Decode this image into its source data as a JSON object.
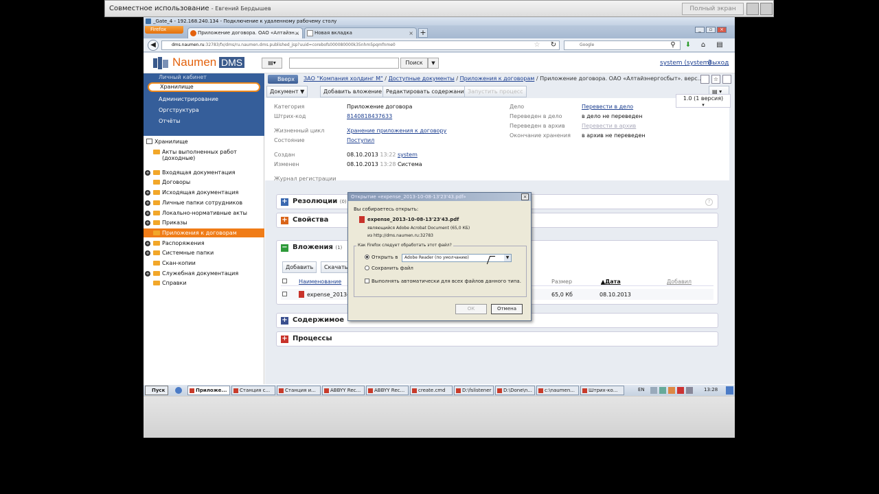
{
  "share": {
    "title": "Совместное использование",
    "presenter": "- Евгений Бердышев",
    "fullscreen": "Полный экран"
  },
  "rdp": {
    "title": "_Gate_4 - 192.168.240.134 - Подключение к удаленному рабочему столу"
  },
  "firefox": {
    "menu_label": "Firefox",
    "tabs": [
      {
        "label": "Приложение договора. ОАО «Алтайэн...",
        "close": "×"
      },
      {
        "label": "Новая вкладка",
        "close": "×"
      }
    ],
    "new_tab": "+",
    "url_host": "dms.naumen.ru",
    "url_rest": ":32783/fx/dms/ru.naumen.dms.published_jsp?uuid=corebofs000080000k35nhm5pqmfnme0",
    "search_placeholder": "Google"
  },
  "header": {
    "logo": "Naumen",
    "logo_dms": "DMS",
    "search_btn": "Поиск",
    "user": "system (system)",
    "logout": "Выход"
  },
  "sidebar": {
    "top_items": [
      "Личный кабинет",
      "Хранилище",
      "Администрирование",
      "Оргструктура",
      "Отчёты"
    ],
    "tree_root": "Хранилище",
    "tree": [
      {
        "label": "Акты выполненных работ",
        "label2": "(доходные)",
        "plus": false
      },
      {
        "label": "Входящая документация",
        "plus": true
      },
      {
        "label": "Договоры",
        "plus": false
      },
      {
        "label": "Исходящая документация",
        "plus": true
      },
      {
        "label": "Личные папки сотрудников",
        "plus": true
      },
      {
        "label": "Локально-нормативные акты",
        "plus": true
      },
      {
        "label": "Приказы",
        "plus": true
      },
      {
        "label": "Приложения к договорам",
        "plus": false
      },
      {
        "label": "Распоряжения",
        "plus": true
      },
      {
        "label": "Системные папки",
        "plus": true
      },
      {
        "label": "Скан-копии",
        "plus": false
      },
      {
        "label": "Служебная документация",
        "plus": true
      },
      {
        "label": "Справки",
        "plus": false
      }
    ]
  },
  "main": {
    "up": "Вверх",
    "crumbs": [
      {
        "text": "ЗАО \"Компания холдинг М\"",
        "link": true
      },
      {
        "text": " / ",
        "link": false
      },
      {
        "text": "Доступные документы",
        "link": true
      },
      {
        "text": " / ",
        "link": false
      },
      {
        "text": "Приложения к договорам",
        "link": true
      },
      {
        "text": " / Приложение договора. ОАО «Алтайэнергосбыт». верс...",
        "link": false
      }
    ],
    "actions": [
      "Документ ▼",
      "Добавить вложение",
      "Редактировать содержание",
      "Запустить процесс"
    ],
    "version": "1.0 (1 версия)",
    "fields": {
      "category_l": "Категория",
      "category_v": "Приложение договора",
      "barcode_l": "Штрих-код",
      "barcode_v": "8140818437633",
      "lifecycle_l": "Жизненный цикл",
      "lifecycle_v": "Хранение приложения к договору",
      "state_l": "Состояние",
      "state_v": "Поступил",
      "created_l": "Создан",
      "created_date": "08.10.2013",
      "created_time": "13:22",
      "created_by": "system",
      "changed_l": "Изменен",
      "changed_date": "08.10.2013",
      "changed_time": "13:28",
      "changed_by": "Система",
      "journal_l": "Журнал регистрации",
      "case_l": "Дело",
      "case_v": "Перевести в дело",
      "to_case_l": "Переведен в дело",
      "to_case_v": "в дело не переведен",
      "to_archive_l": "Переведен в архив",
      "to_archive_v": "Перевести в архив",
      "storage_end_l": "Окончание хранения",
      "storage_end_v": "в архив не переведен"
    },
    "sections": {
      "resolutions": "Резолюции",
      "resolutions_cnt": "(0)",
      "properties": "Свойства",
      "attachments": "Вложения",
      "attachments_cnt": "(1)",
      "content": "Содержимое",
      "processes": "Процессы"
    },
    "attach": {
      "add": "Добавить",
      "download": "Скачать",
      "col_name": "Наименование",
      "col_size": "Размер",
      "col_date": "Дата",
      "col_added": "Добавил",
      "file": "expense_2013-",
      "size": "65,0 Кб",
      "date": "08.10.2013"
    }
  },
  "dialog": {
    "title": "Открытие «expense_2013-10-08-13'23'43.pdf»",
    "intro": "Вы собираетесь открыть:",
    "filename": "expense_2013-10-08-13'23'43.pdf",
    "type": "являющийся  Adobe Acrobat Document (65,0 КБ)",
    "from": "из  http://dms.naumen.ru:32783",
    "question": "Как Firefox следует обработать этот файл?",
    "open_with": "Открыть в",
    "app": "Adobe Reader  (по умолчанию)",
    "save": "Сохранить файл",
    "auto": "Выполнять автоматически для всех файлов данного типа.",
    "ok": "ОК",
    "cancel": "Отмена"
  },
  "taskbar": {
    "start": "Пуск",
    "tasks": [
      "Приложе...",
      "Станция с...",
      "Станция и...",
      "ABBYY Rec...",
      "ABBYY Rec...",
      "create.cmd",
      "D:\\fslistener",
      "D:\\Done\\n...",
      "c:\\naumen...",
      "Штрих-ко..."
    ],
    "lang": "EN",
    "clock": "13:28"
  },
  "colors": {
    "accent": "#e3620e",
    "nav_blue": "#355e9a",
    "selected": "#f07c17"
  }
}
